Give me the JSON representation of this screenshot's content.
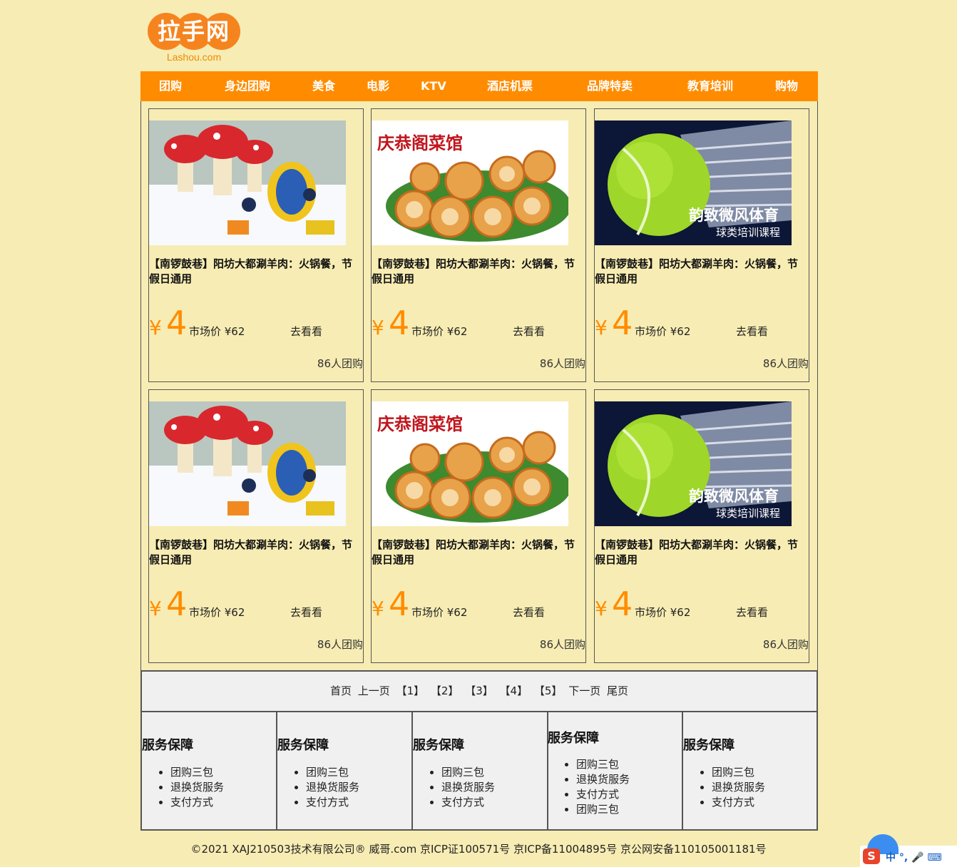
{
  "logo": {
    "text": "拉手网",
    "sub": "Lashou.com"
  },
  "nav": [
    "团购",
    "身边团购",
    "美食",
    "电影",
    "KTV",
    "酒店机票",
    "品牌特卖",
    "教育培训",
    "购物"
  ],
  "products": [
    {
      "image": "snow-park-photo",
      "title": "【南锣鼓巷】阳坊大都涮羊肉：火锅餐，节假日通用",
      "yen": "¥",
      "price": "4",
      "market": "市场价 ¥62",
      "action": "去看看",
      "count": "86人团购"
    },
    {
      "image": "food-dumplings-photo",
      "title": "【南锣鼓巷】阳坊大都涮羊肉：火锅餐，节假日通用",
      "yen": "¥",
      "price": "4",
      "market": "市场价 ¥62",
      "action": "去看看",
      "count": "86人团购",
      "image_text": "庆恭阁菜馆"
    },
    {
      "image": "tennis-ball-photo",
      "title": "【南锣鼓巷】阳坊大都涮羊肉：火锅餐，节假日通用",
      "yen": "¥",
      "price": "4",
      "market": "市场价 ¥62",
      "action": "去看看",
      "count": "86人团购",
      "image_text": "韵致微风体育",
      "image_sub": "球类培训课程"
    },
    {
      "image": "snow-park-photo",
      "title": "【南锣鼓巷】阳坊大都涮羊肉：火锅餐，节假日通用",
      "yen": "¥",
      "price": "4",
      "market": "市场价 ¥62",
      "action": "去看看",
      "count": "86人团购"
    },
    {
      "image": "food-dumplings-photo",
      "title": "【南锣鼓巷】阳坊大都涮羊肉：火锅餐，节假日通用",
      "yen": "¥",
      "price": "4",
      "market": "市场价 ¥62",
      "action": "去看看",
      "count": "86人团购",
      "image_text": "庆恭阁菜馆"
    },
    {
      "image": "tennis-ball-photo",
      "title": "【南锣鼓巷】阳坊大都涮羊肉：火锅餐，节假日通用",
      "yen": "¥",
      "price": "4",
      "market": "市场价 ¥62",
      "action": "去看看",
      "count": "86人团购",
      "image_text": "韵致微风体育",
      "image_sub": "球类培训课程"
    }
  ],
  "pager": [
    "首页",
    "上一页",
    "【1】",
    "【2】",
    "【3】",
    "【4】",
    "【5】",
    "下一页",
    "尾页"
  ],
  "footer": [
    {
      "title": "服务保障",
      "items": [
        "团购三包",
        "退换货服务",
        "支付方式"
      ]
    },
    {
      "title": "服务保障",
      "items": [
        "团购三包",
        "退换货服务",
        "支付方式"
      ]
    },
    {
      "title": "服务保障",
      "items": [
        "团购三包",
        "退换货服务",
        "支付方式"
      ]
    },
    {
      "title": "服务保障",
      "items": [
        "团购三包",
        "退换货服务",
        "支付方式",
        "团购三包"
      ]
    },
    {
      "title": "服务保障",
      "items": [
        "团购三包",
        "退换货服务",
        "支付方式"
      ]
    }
  ],
  "copyright": "©2021 XAJ210503技术有限公司® 威哥.com 京ICP证100571号 京ICP备11004895号 京公网安备110105001181号",
  "ime": {
    "logo": "S",
    "text": "中 °, 🎤 ⌨"
  },
  "colors": {
    "background": "#f7ecb3",
    "nav": "#ff8c00",
    "accent": "#ff8c00",
    "panel": "#f0f0f0"
  }
}
